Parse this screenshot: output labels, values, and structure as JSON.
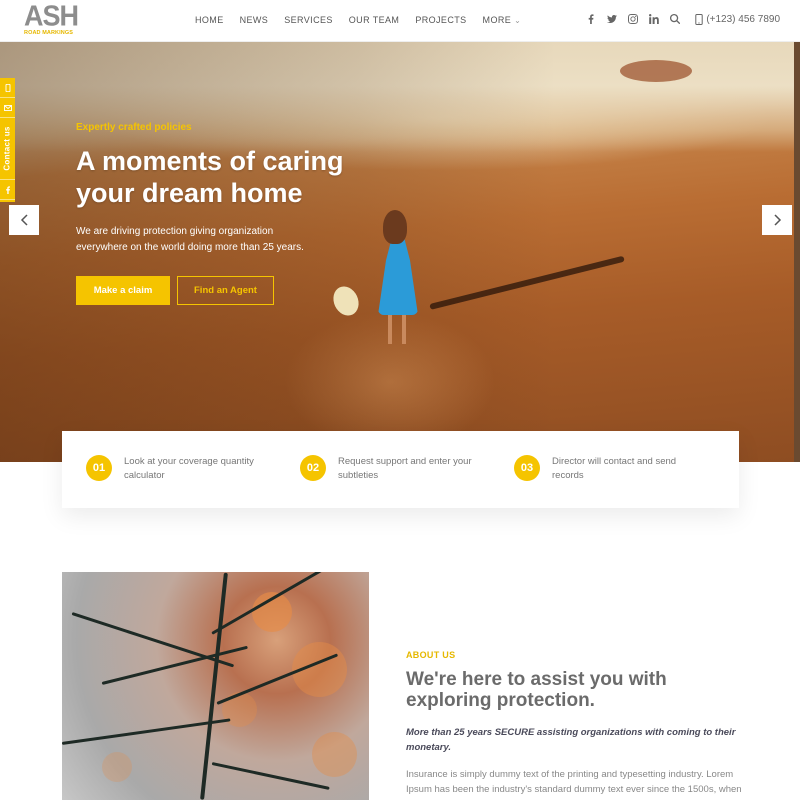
{
  "logo": {
    "main": "ASH",
    "sub": "ROAD MARKINGS"
  },
  "nav": {
    "items": [
      "HOME",
      "NEWS",
      "SERVICES",
      "OUR TEAM",
      "PROJECTS",
      "MORE"
    ]
  },
  "header": {
    "phone": "(+123) 456 7890",
    "social": [
      "facebook-icon",
      "twitter-icon",
      "instagram-icon",
      "linkedin-icon",
      "search-icon"
    ]
  },
  "side_bar": {
    "contact_label": "Contact us"
  },
  "hero": {
    "kicker": "Expertly crafted policies",
    "title_line1": "A moments of caring",
    "title_line2": "your dream home",
    "text_line1": "We are driving protection giving organization",
    "text_line2": "everywhere on the world doing more than 25 years.",
    "primary_button": "Make a claim",
    "secondary_button": "Find an Agent"
  },
  "steps": [
    {
      "num": "01",
      "text": "Look at your coverage quantity calculator"
    },
    {
      "num": "02",
      "text": "Request support and enter your subtleties"
    },
    {
      "num": "03",
      "text": "Director will contact and send records"
    }
  ],
  "about": {
    "kicker": "ABOUT US",
    "title_line1": "We're here to assist you with",
    "title_line2": "exploring protection.",
    "lead": "More than 25 years SECURE assisting organizations with coming to their monetary.",
    "body": "Insurance is simply dummy text of the printing and typesetting industry. Lorem Ipsum has been the industry's standard dummy text ever since the 1500s, when an unknown printer took a galley of type and scrambled it to make a type"
  },
  "colors": {
    "accent": "#f5c400",
    "text": "#555555"
  }
}
